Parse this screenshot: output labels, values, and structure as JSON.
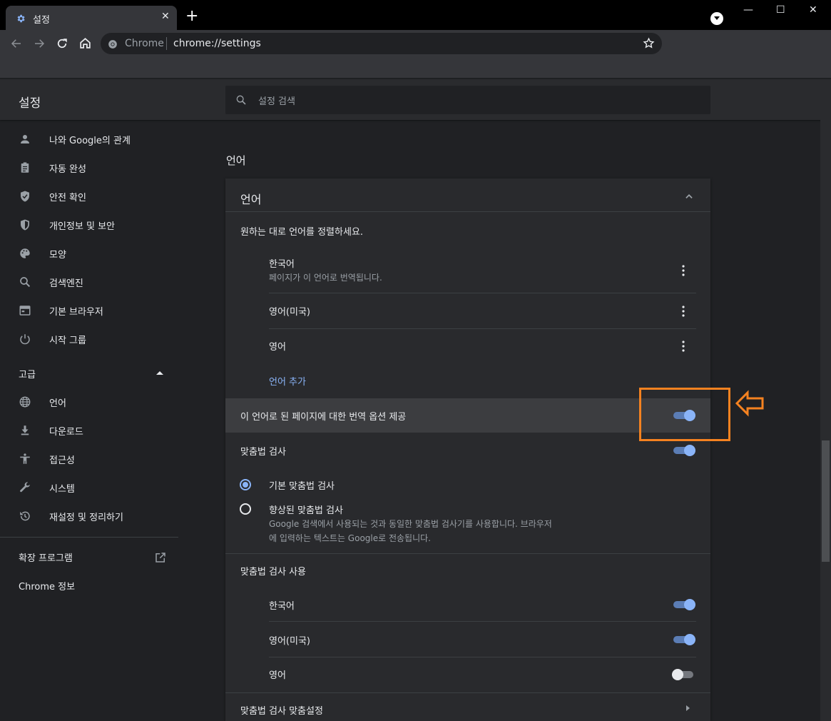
{
  "browser": {
    "tab_title": "설정",
    "tab_close": "✕",
    "new_tab": "+",
    "omnibox_site": "Chrome",
    "omnibox_url": "chrome://settings",
    "win_min": "—",
    "win_max": "☐",
    "win_close": "✕"
  },
  "header": {
    "title": "설정",
    "search_placeholder": "설정 검색"
  },
  "sidebar": {
    "items": [
      {
        "label": "나와 Google의 관계",
        "icon": "person-icon"
      },
      {
        "label": "자동 완성",
        "icon": "clipboard-icon"
      },
      {
        "label": "안전 확인",
        "icon": "shield-check-icon"
      },
      {
        "label": "개인정보 및 보안",
        "icon": "shield-icon"
      },
      {
        "label": "모양",
        "icon": "palette-icon"
      },
      {
        "label": "검색엔진",
        "icon": "search-icon"
      },
      {
        "label": "기본 브라우저",
        "icon": "browser-icon"
      },
      {
        "label": "시작 그룹",
        "icon": "power-icon"
      }
    ],
    "advanced_label": "고급",
    "advanced_items": [
      {
        "label": "언어",
        "icon": "globe-icon"
      },
      {
        "label": "다운로드",
        "icon": "download-icon"
      },
      {
        "label": "접근성",
        "icon": "accessibility-icon"
      },
      {
        "label": "시스템",
        "icon": "wrench-icon"
      },
      {
        "label": "재설정 및 정리하기",
        "icon": "history-icon"
      }
    ],
    "extensions_label": "확장 프로그램",
    "about_label": "Chrome 정보"
  },
  "main": {
    "section_title": "언어",
    "card_title": "언어",
    "order_hint": "원하는 대로 언어를 정렬하세요.",
    "languages": [
      {
        "name": "한국어",
        "sub": "페이지가 이 언어로 번역됩니다."
      },
      {
        "name": "영어(미국)",
        "sub": ""
      },
      {
        "name": "영어",
        "sub": ""
      }
    ],
    "add_language": "언어 추가",
    "translate_offer": "이 언어로 된 페이지에 대한 번역 옵션 제공",
    "spellcheck": "맞춤법 검사",
    "basic_spellcheck": "기본 맞춤법 검사",
    "enhanced_spellcheck": "향상된 맞춤법 검사",
    "enhanced_desc_1": "Google 검색에서 사용되는 것과 동일한 맞춤법 검사기를 사용합니다. 브라우저",
    "enhanced_desc_2": "에 입력하는 텍스트는 Google로 전송됩니다.",
    "spellcheck_use": "맞춤법 검사 사용",
    "spell_languages": [
      {
        "name": "한국어",
        "on": true
      },
      {
        "name": "영어(미국)",
        "on": true
      },
      {
        "name": "영어",
        "on": false
      }
    ],
    "customize_spellcheck": "맞춤법 검사 맞춤설정"
  },
  "colors": {
    "accent": "#8ab4f8",
    "highlight": "#f58220",
    "link": "#8ab4f8"
  }
}
